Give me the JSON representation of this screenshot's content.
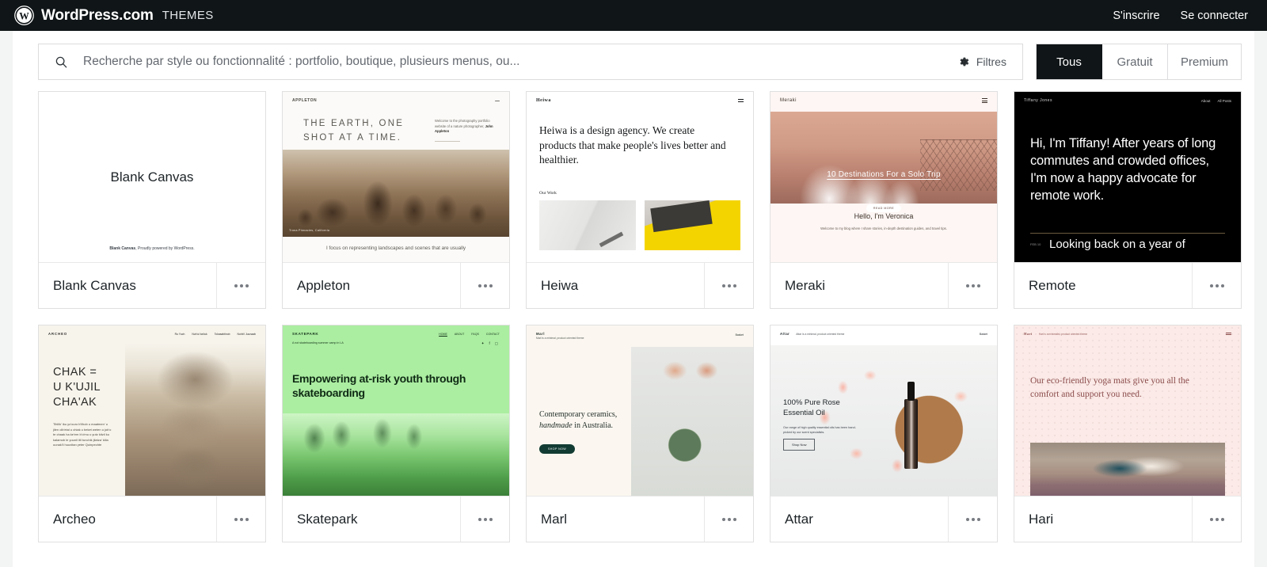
{
  "masthead": {
    "logo_icon": "wordpress-logo-icon",
    "brand": "WordPress.com",
    "section": "THEMES",
    "signup": "S'inscrire",
    "login": "Se connecter"
  },
  "search": {
    "icon": "search-icon",
    "placeholder": "Recherche par style ou fonctionnalité : portfolio, boutique, plusieurs menus, ou...",
    "value": "",
    "filters_icon": "gear-icon",
    "filters_label": "Filtres"
  },
  "tabs": [
    {
      "label": "Tous",
      "active": true
    },
    {
      "label": "Gratuit",
      "active": false
    },
    {
      "label": "Premium",
      "active": false
    }
  ],
  "colors": {
    "masthead_bg": "#101517",
    "active_tab_bg": "#101517",
    "surface_bg": "#ffffff",
    "page_bg": "#f3f4f4",
    "card_border": "#e0e0e0"
  },
  "themes": [
    {
      "name": "Blank Canvas",
      "menu_icon": "ellipsis-icon",
      "preview": {
        "kind": "blank-canvas",
        "title": "Blank Canvas",
        "footer_brand": "Blank Canvas",
        "footer_text": ", Proudly powered by WordPress."
      }
    },
    {
      "name": "Appleton",
      "menu_icon": "ellipsis-icon",
      "preview": {
        "kind": "appleton",
        "site_logo": "APPLETON",
        "heading": "THE EARTH, ONE\nSHOT AT A TIME.",
        "blurb_lead": "Welcome to the photography portfolio website of a nature photographer, ",
        "blurb_name": "John Appleton",
        "image_caption": "Trona Pinnacles, California",
        "subtitle": "I focus on representing landscapes and scenes that are usually"
      }
    },
    {
      "name": "Heiwa",
      "menu_icon": "ellipsis-icon",
      "preview": {
        "kind": "heiwa",
        "site_logo": "Heiwa",
        "menu_icon": "hamburger-icon",
        "heading": "Heiwa is a design agency. We create products that make people's lives better and healthier.",
        "section_label": "Our Work"
      }
    },
    {
      "name": "Meraki",
      "menu_icon": "ellipsis-icon",
      "preview": {
        "kind": "meraki",
        "site_logo": "Meraki",
        "menu_icon": "hamburger-icon",
        "hero_title": "10 Destinations For a Solo Trip",
        "hero_button": "READ MORE",
        "heading": "Hello, I'm Veronica",
        "subtitle": "Welcome to my blog where I share stories, in-depth destination guides, and travel tips."
      }
    },
    {
      "name": "Remote",
      "menu_icon": "ellipsis-icon",
      "preview": {
        "kind": "remote",
        "site_logo": "Tiffany Jones",
        "nav": [
          "About",
          "All Posts"
        ],
        "heading": "Hi, I'm Tiffany! After years of long commutes and crowded offices, I'm now a happy advocate for remote work.",
        "post_date": "FEB 10",
        "post_title": "Looking back on a year of"
      }
    },
    {
      "name": "Archeo",
      "menu_icon": "ellipsis-icon",
      "preview": {
        "kind": "archeo",
        "site_logo": "ARCHEO",
        "nav": [
          "Ru Yuch",
          "Nuh'ul ba'tuk",
          "Tolwaabtinob",
          "Nohb'i Juunaab"
        ],
        "heading": "CHAK =\nU K'UJIL\nCHA'AK",
        "body": "Tihilik' iku yo'ouro b'ilhob u maatmen' u jilen olb'etal u chiak u beket weten u job'o te chaak ha ke'em b'o'mu u yutz kitzil ku kalamob le yuunil itil tunchik jilatza' kiila uunak'il huuxitan yeter Quinpechte"
      }
    },
    {
      "name": "Skatepark",
      "menu_icon": "ellipsis-icon",
      "preview": {
        "kind": "skatepark",
        "site_logo": "SKATEPARK",
        "tagline": "A not skateboarding summer camp in LA",
        "nav": [
          "HOME",
          "ABOUT",
          "FAQS",
          "CONTACT"
        ],
        "social": [
          "twitter-icon",
          "facebook-icon",
          "instagram-icon"
        ],
        "heading": "Empowering at-risk youth through skateboarding"
      }
    },
    {
      "name": "Marl",
      "menu_icon": "ellipsis-icon",
      "preview": {
        "kind": "marl",
        "site_logo": "Marl",
        "tagline": "Marl is a minimal, product oriented theme",
        "nav_right": "Basket",
        "heading_line1": "Contemporary ceramics,",
        "heading_em": "handmade",
        "heading_line2": " in Australia.",
        "button": "SHOP NOW"
      }
    },
    {
      "name": "Attar",
      "menu_icon": "ellipsis-icon",
      "preview": {
        "kind": "attar",
        "site_logo": "Attar",
        "tagline": "Attar is a minimal, product oriented theme",
        "nav_right": "Basket",
        "heading": "100% Pure Rose Essential Oil",
        "body": "Our range of high quality essential oils has been hand-picked by our scent specialists.",
        "button": "Shop Now"
      }
    },
    {
      "name": "Hari",
      "menu_icon": "ellipsis-icon",
      "preview": {
        "kind": "hari",
        "site_logo": "Hari",
        "tagline": "Hari is a minimalist, product oriented theme",
        "menu_icon": "hamburger-icon",
        "heading": "Our eco-friendly yoga mats give you all the comfort and support you need."
      }
    }
  ]
}
